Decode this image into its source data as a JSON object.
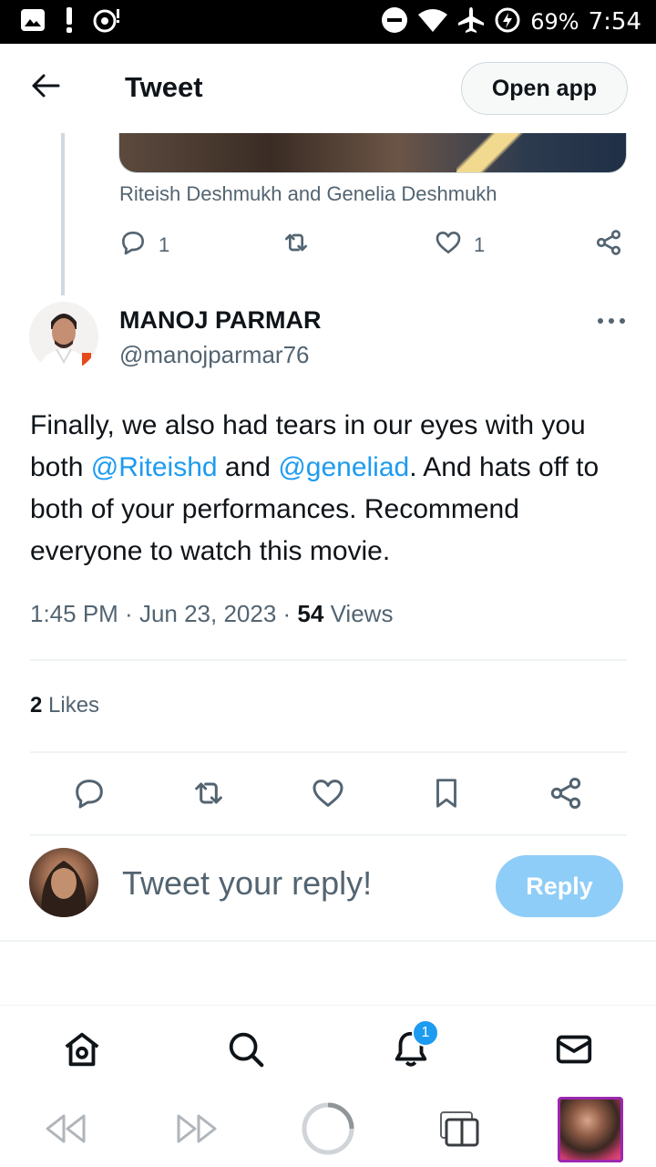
{
  "status_bar": {
    "battery_percent": "69%",
    "time": "7:54",
    "icons": [
      "gallery-icon",
      "alert-icon",
      "sync-icon",
      "dnd-icon",
      "wifi-icon",
      "airplane-icon",
      "battery-saver-icon"
    ]
  },
  "header": {
    "title": "Tweet",
    "open_app_label": "Open app"
  },
  "previous_tweet": {
    "media_caption": "Riteish Deshmukh and Genelia Deshmukh",
    "reply_count": "1",
    "like_count": "1"
  },
  "tweet": {
    "author_name": "MANOJ PARMAR",
    "author_handle": "@manojparmar76",
    "text_part1": "Finally, we also had tears in our eyes with you both ",
    "mention1": "@Riteishd",
    "text_part2": " and ",
    "mention2": "@geneliad",
    "text_part3": ". And hats off to both of your performances. Recommend everyone to watch this movie.",
    "time": "1:45 PM",
    "date": "Jun 23, 2023",
    "views_count": "54",
    "views_label": "Views",
    "likes_count": "2",
    "likes_label": "Likes"
  },
  "reply": {
    "placeholder": "Tweet your reply!",
    "button_label": "Reply"
  },
  "bottom_nav": {
    "notification_badge": "1"
  },
  "colors": {
    "accent": "#1d9bf0",
    "reply_button": "#8ecdf8",
    "secondary_text": "#536471"
  }
}
